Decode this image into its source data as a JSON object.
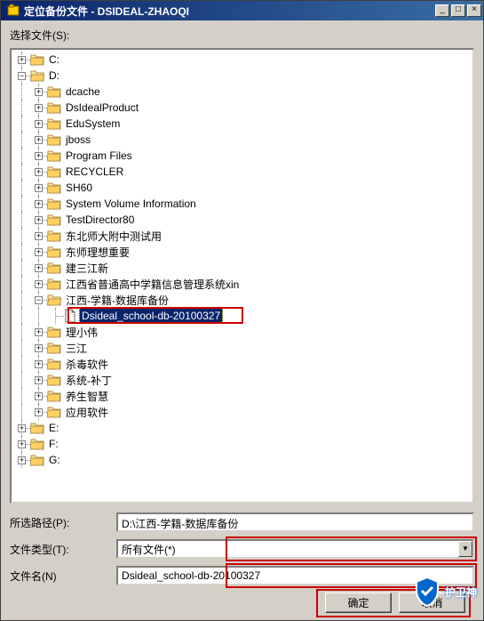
{
  "title": "定位备份文件 - DSIDEAL-ZHAOQI",
  "select_label": "选择文件(S):",
  "drives": [
    {
      "label": "C:",
      "expanded": false,
      "depth": 0
    },
    {
      "label": "D:",
      "expanded": true,
      "depth": 0
    },
    {
      "label": "dcache",
      "expanded": false,
      "depth": 1
    },
    {
      "label": "DsIdealProduct",
      "expanded": false,
      "depth": 1
    },
    {
      "label": "EduSystem",
      "expanded": false,
      "depth": 1
    },
    {
      "label": "jboss",
      "expanded": false,
      "depth": 1
    },
    {
      "label": "Program Files",
      "expanded": false,
      "depth": 1
    },
    {
      "label": "RECYCLER",
      "expanded": false,
      "depth": 1
    },
    {
      "label": "SH60",
      "expanded": false,
      "depth": 1
    },
    {
      "label": "System Volume Information",
      "expanded": false,
      "depth": 1
    },
    {
      "label": "TestDirector80",
      "expanded": false,
      "depth": 1
    },
    {
      "label": "东北师大附中测试用",
      "expanded": false,
      "depth": 1
    },
    {
      "label": "东师理想重要",
      "expanded": false,
      "depth": 1
    },
    {
      "label": "建三江新",
      "expanded": false,
      "depth": 1
    },
    {
      "label": "江西省普通高中学籍信息管理系统xin",
      "expanded": false,
      "depth": 1
    },
    {
      "label": "江西-学籍-数据库备份",
      "expanded": true,
      "depth": 1
    },
    {
      "label": "Dsideal_school-db-20100327",
      "file": true,
      "depth": 2,
      "selected": true
    },
    {
      "label": "理小伟",
      "expanded": false,
      "depth": 1
    },
    {
      "label": "三江",
      "expanded": false,
      "depth": 1
    },
    {
      "label": "杀毒软件",
      "expanded": false,
      "depth": 1
    },
    {
      "label": "系统-补丁",
      "expanded": false,
      "depth": 1
    },
    {
      "label": "养生智慧",
      "expanded": false,
      "depth": 1
    },
    {
      "label": "应用软件",
      "expanded": false,
      "depth": 1
    },
    {
      "label": "E:",
      "expanded": false,
      "depth": 0
    },
    {
      "label": "F:",
      "expanded": false,
      "depth": 0
    },
    {
      "label": "G:",
      "expanded": false,
      "depth": 0
    }
  ],
  "form": {
    "path_label": "所选路径(P):",
    "path_value": "D:\\江西-学籍-数据库备份",
    "type_label": "文件类型(T):",
    "type_value": "所有文件(*)",
    "name_label": "文件名(N)",
    "name_value": "Dsideal_school-db-20100327"
  },
  "buttons": {
    "ok": "确定",
    "cancel": "取消"
  },
  "watermark": "护卫神"
}
